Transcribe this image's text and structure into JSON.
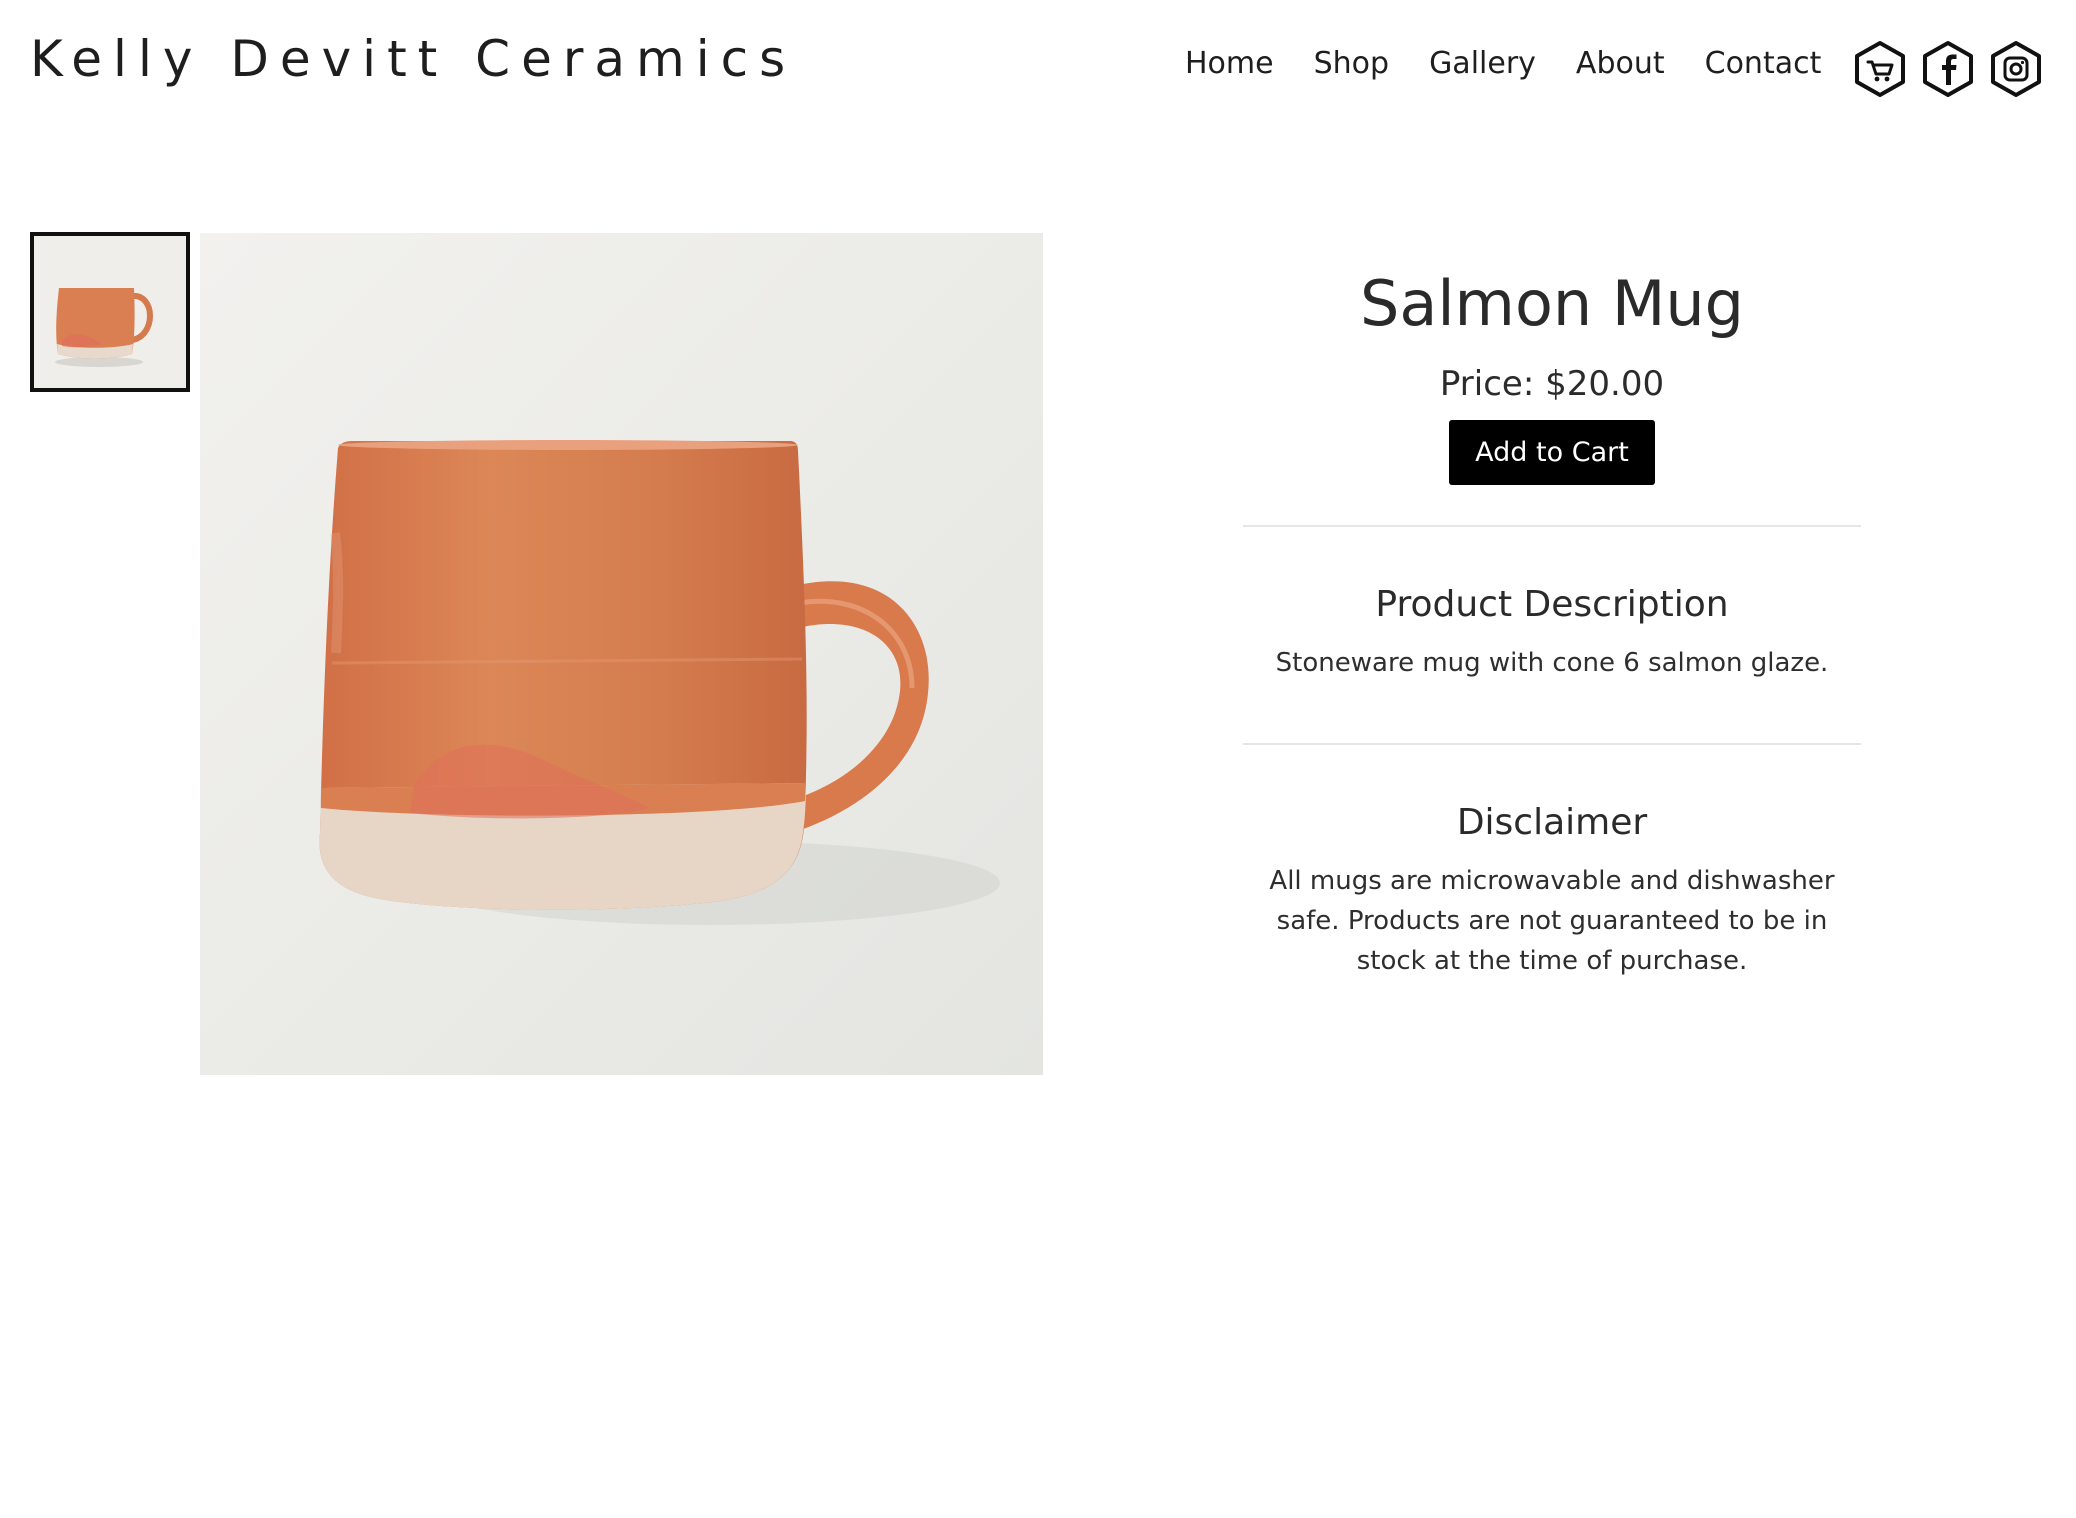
{
  "header": {
    "site_title": "Kelly Devitt Ceramics",
    "nav": [
      {
        "label": "Home"
      },
      {
        "label": "Shop"
      },
      {
        "label": "Gallery"
      },
      {
        "label": "About"
      },
      {
        "label": "Contact"
      }
    ],
    "social_icons": [
      "cart-icon",
      "facebook-icon",
      "instagram-icon"
    ]
  },
  "product": {
    "title": "Salmon Mug",
    "price_label": "Price:",
    "price": "$20.00",
    "add_to_cart_label": "Add to Cart",
    "glaze_color": "#d97f52",
    "description_heading": "Product Description",
    "description_text": "Stoneware mug with cone 6 salmon glaze.",
    "disclaimer_heading": "Disclaimer",
    "disclaimer_text": "All mugs are microwavable and dishwasher safe. Products are not guaranteed to be in stock at the time of purchase."
  },
  "colors": {
    "button_bg": "#000000",
    "button_text": "#ffffff",
    "text": "#2b2b2b"
  }
}
